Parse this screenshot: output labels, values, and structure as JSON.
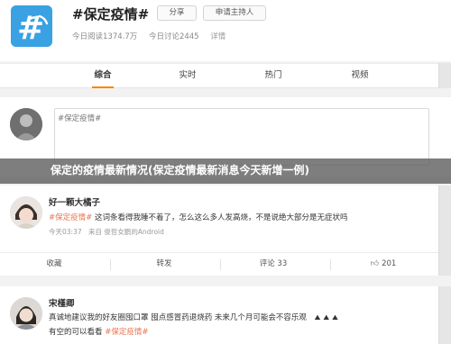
{
  "topic": {
    "title": "#保定疫情#",
    "share_label": "分享",
    "host_label": "申请主持人",
    "reads": "今日阅读1374.7万",
    "discussions": "今日讨论2445",
    "details_label": "详情",
    "logo_color": "#3aa1e3"
  },
  "tabs": [
    {
      "label": "综合"
    },
    {
      "label": "实时"
    },
    {
      "label": "热门"
    },
    {
      "label": "视频"
    }
  ],
  "compose": {
    "placeholder": "#保定疫情#"
  },
  "banner": {
    "text": "保定的疫情最新情况(保定疫情最新消息今天新增一例)"
  },
  "posts": [
    {
      "username": "好一颗大橘子",
      "hashtag": "#保定疫情#",
      "text": " 这词条看得我睡不着了，怎么这么多人发高烧，不是说绝大部分是无症状吗",
      "time": "今天03:37",
      "source": "来自 俊哲女鹏的Android",
      "actions": {
        "favorite": "收藏",
        "repost": "转发",
        "comment": "评论 33",
        "like": "201"
      }
    },
    {
      "username": "宋槿卿",
      "line1": "真诚地建议我的好友圈囤口罩 囤点感冒药退烧药 未来几个月可能会不容乐观",
      "line2_prefix": "有空的可以看看 ",
      "hashtag": "#保定疫情#"
    }
  ],
  "colors": {
    "accent": "#ff8200",
    "hashtag": "#eb7350",
    "page_bg": "#f2f2f2"
  }
}
